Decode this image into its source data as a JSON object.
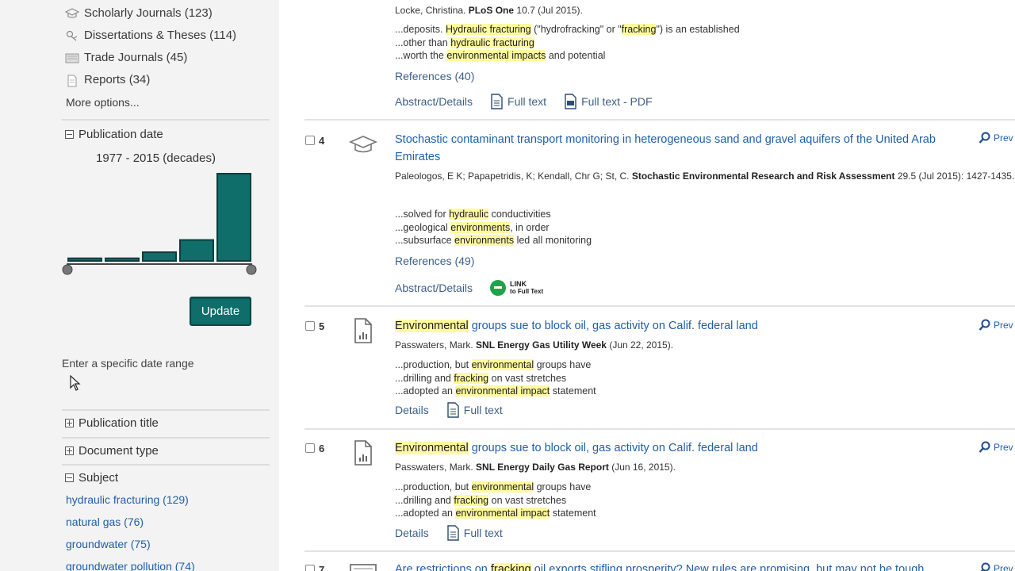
{
  "sidebar": {
    "source_types": [
      {
        "icon": "journal-icon",
        "label": "Scholarly Journals (123)"
      },
      {
        "icon": "dissertation-icon",
        "label": "Dissertations & Theses (114)"
      },
      {
        "icon": "trade-journal-icon",
        "label": "Trade Journals (45)"
      },
      {
        "icon": "report-icon",
        "label": "Reports (34)"
      }
    ],
    "more_options": "More options...",
    "publication_date": {
      "heading": "Publication date",
      "range_label": "1977 - 2015 (decades)",
      "histogram": {
        "values": [
          3,
          3,
          10,
          24,
          100
        ]
      },
      "update_label": "Update",
      "specific_range": "Enter a specific date range"
    },
    "publication_title": "Publication title",
    "document_type": "Document type",
    "subject": {
      "heading": "Subject",
      "items": [
        "hydraulic fracturing (129)",
        "natural gas (76)",
        "groundwater (75)",
        "groundwater pollution (74)"
      ]
    }
  },
  "results": {
    "r3": {
      "meta_prefix": "Locke, Christina. ",
      "meta_journal": "PLoS One",
      "meta_suffix": " 10.7  (Jul 2015).",
      "snippets": [
        [
          "...deposits. ",
          "Hydraulic fracturing",
          " (\"hydrofracking\" or \"",
          "fracking",
          "\") is an established"
        ],
        [
          "...other than ",
          "hydraulic fracturing",
          "",
          "",
          ""
        ],
        [
          "...worth the ",
          "environmental impacts",
          " and potential",
          "",
          ""
        ]
      ],
      "refs": "References (40)",
      "actions": [
        "Abstract/Details",
        "Full text",
        "Full text - PDF"
      ]
    },
    "r4": {
      "number": "4",
      "title": "Stochastic contaminant transport monitoring in heterogeneous sand and gravel aquifers of the United Arab Emirates",
      "meta_prefix": "Paleologos, E K; Papapetridis, K; Kendall, Chr G; St, C. ",
      "meta_journal": "Stochastic Environmental Research and Risk Assessment",
      "meta_suffix": " 29.5  (Jul 2015): 1427-1435.",
      "snippets": [
        [
          "...solved for ",
          "hydraulic",
          " conductivities"
        ],
        [
          "...geological ",
          "environments",
          ", in order"
        ],
        [
          "...subsurface ",
          "environments",
          " led all monitoring"
        ]
      ],
      "refs": "References (49)",
      "actions": [
        "Abstract/Details"
      ],
      "link_badge_top": "LINK",
      "link_badge_bottom": "to Full Text",
      "preview": "Prev"
    },
    "r5": {
      "number": "5",
      "title_hl": "Environmental",
      "title_rest": " groups sue to block oil, gas activity on Calif. federal land",
      "meta_prefix": "Passwaters, Mark. ",
      "meta_journal": "SNL Energy Gas Utility Week",
      "meta_suffix": "  (Jun 22, 2015).",
      "snippets": [
        [
          "...production, but ",
          "environmental",
          " groups have"
        ],
        [
          "...drilling and ",
          "fracking",
          " on vast stretches"
        ],
        [
          "...adopted an ",
          "environmental impact",
          " statement"
        ]
      ],
      "actions": [
        "Details",
        "Full text"
      ],
      "preview": "Prev"
    },
    "r6": {
      "number": "6",
      "title_hl": "Environmental",
      "title_rest": " groups sue to block oil, gas activity on Calif. federal land",
      "meta_prefix": "Passwaters, Mark. ",
      "meta_journal": "SNL Energy Daily Gas Report",
      "meta_suffix": "  (Jun 16, 2015).",
      "snippets": [
        [
          "...production, but ",
          "environmental",
          " groups have"
        ],
        [
          "...drilling and ",
          "fracking",
          " on vast stretches"
        ],
        [
          "...adopted an ",
          "environmental impact",
          " statement"
        ]
      ],
      "actions": [
        "Details",
        "Full text"
      ],
      "preview": "Prev"
    },
    "r7": {
      "number": "7",
      "title_pre": "Are restrictions on ",
      "title_hl": "fracking",
      "title_rest": " oil exports stifling prosperity? New rules are promising, but may not be tough",
      "preview": "Prev"
    }
  },
  "colors": {
    "accent": "#0f6d6a",
    "link": "#1f5fa8",
    "highlight": "#fffa9e"
  }
}
